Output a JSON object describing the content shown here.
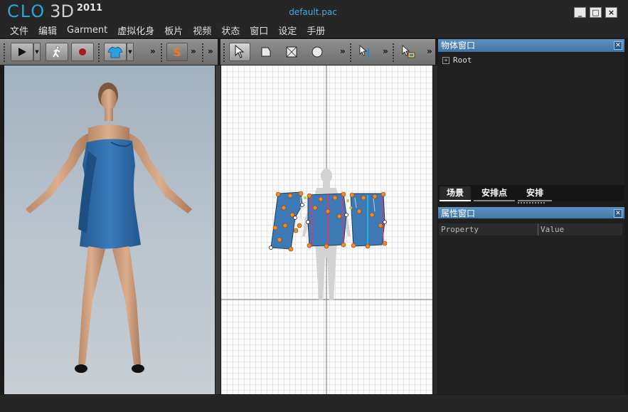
{
  "app": {
    "logo_text": "CLO",
    "logo_3d": "3D",
    "logo_year": "2011",
    "document_title": "default.pac",
    "window_controls": [
      "_",
      "□",
      "×"
    ]
  },
  "menu": [
    "文件",
    "编辑",
    "Garment",
    "虚拟化身",
    "板片",
    "视频",
    "状态",
    "窗口",
    "设定",
    "手册"
  ],
  "toolbar": {
    "sim_letter": "S",
    "overflow": "»"
  },
  "object_panel": {
    "title": "物体窗口",
    "tree_root": "Root"
  },
  "tabs": [
    "场景",
    "安排点",
    "安排"
  ],
  "property_panel": {
    "title": "属性窗口",
    "columns": [
      "Property",
      "Value"
    ]
  },
  "colors": {
    "dress": "#2e6aa8",
    "panel_header": "#4a80b3",
    "pattern_points_orange": "#f08a24",
    "pattern_lines_pink": "#d23c7c"
  }
}
